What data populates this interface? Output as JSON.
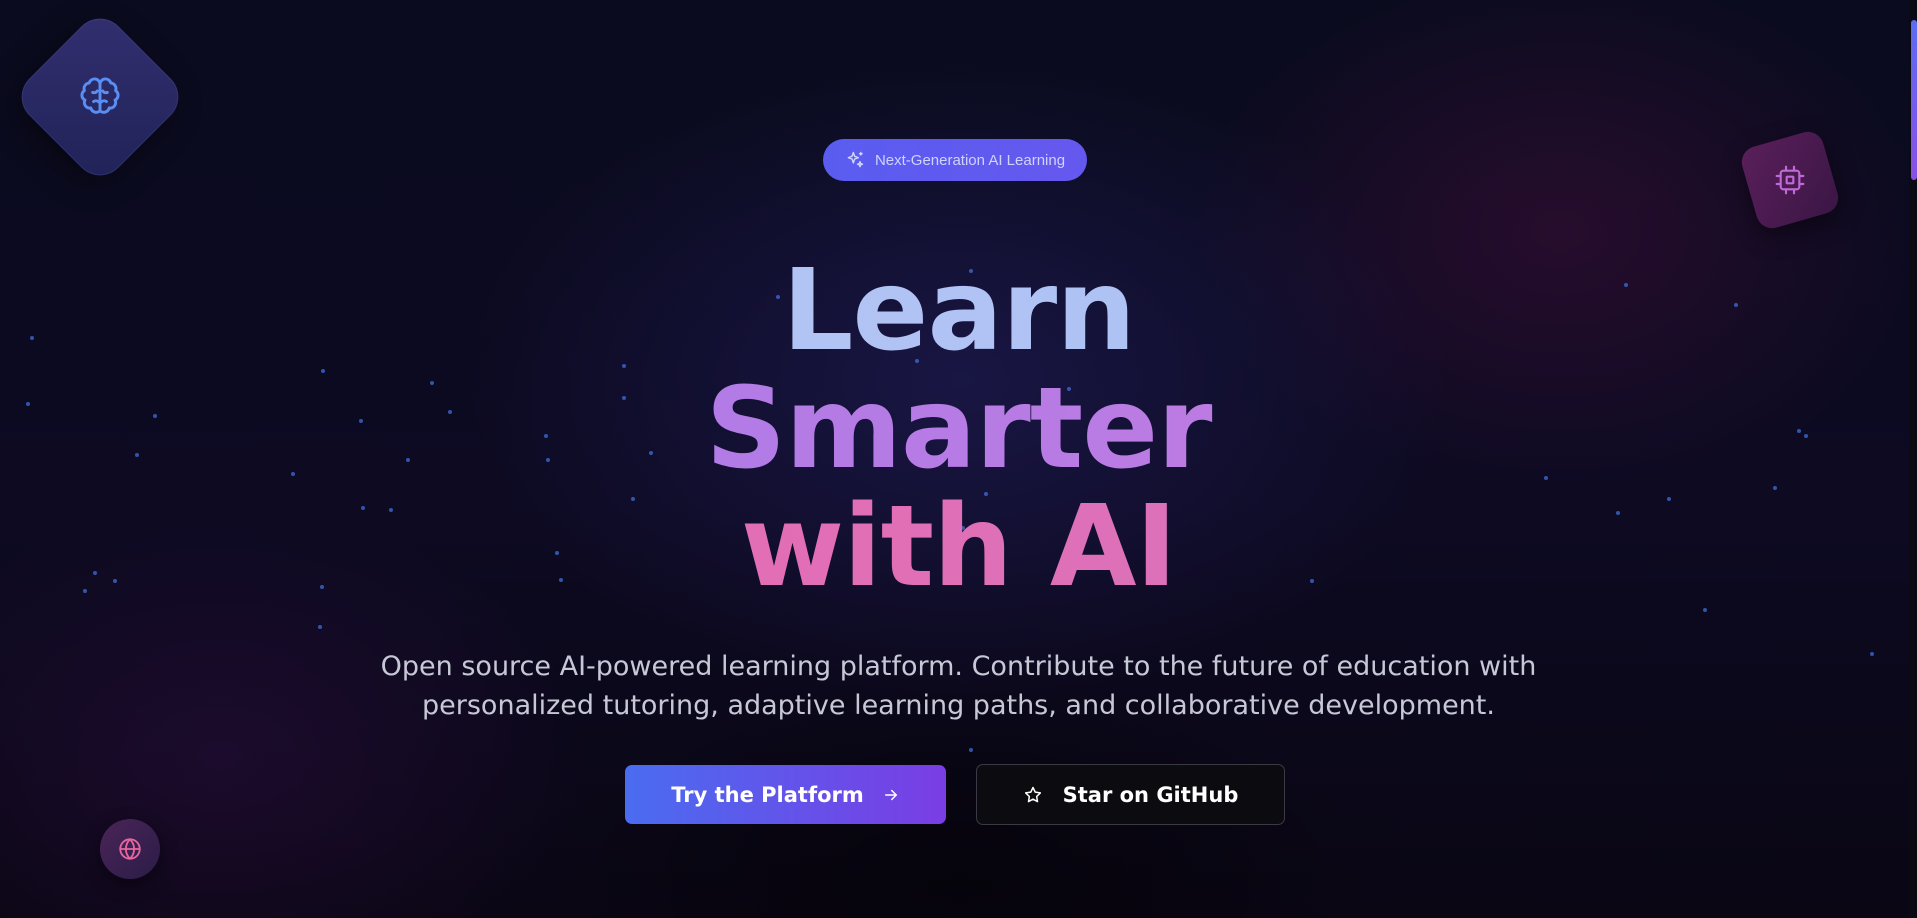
{
  "hero": {
    "badge_label": "Next-Generation AI Learning",
    "headline_line1": "Learn",
    "headline_line2": "Smarter",
    "headline_line3": "with AI",
    "subtitle": "Open source AI-powered learning platform. Contribute to the future of education with personalized tutoring, adaptive learning paths, and collaborative development."
  },
  "actions": {
    "primary_label": "Try the Platform",
    "primary_icon": "arrow-right-icon",
    "secondary_label": "Star on GitHub",
    "secondary_icon": "star-icon"
  },
  "decor": {
    "tiles": [
      "brain-icon",
      "cpu-chip-icon",
      "globe-icon"
    ],
    "badge_icon": "sparkles-icon"
  },
  "colors": {
    "background": "#08081a",
    "badge": "#5a5cf0",
    "headline_line1": "#b7c7f2",
    "headline_line2": "#b57ae6",
    "headline_line3": "#e46bb4",
    "primary_start": "#4a6cf0",
    "primary_end": "#7a3de4",
    "star_dots": "#3e6fd8"
  }
}
